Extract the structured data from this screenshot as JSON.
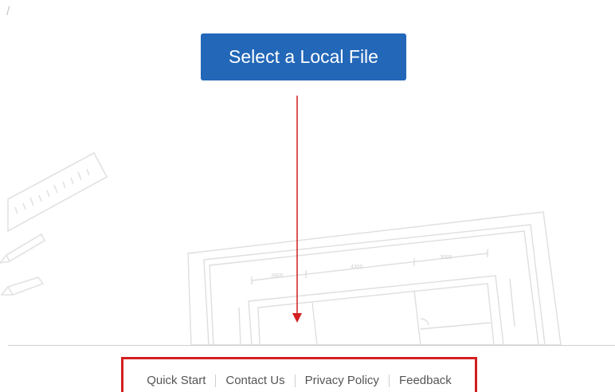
{
  "breadcrumb": {
    "separator": "/"
  },
  "main": {
    "select_button_label": "Select a Local File"
  },
  "footer": {
    "links": [
      "Quick Start",
      "Contact Us",
      "Privacy Policy",
      "Feedback"
    ]
  },
  "colors": {
    "button_bg": "#2267b8",
    "annotation_red": "#d21f1f",
    "footer_text": "#555555"
  },
  "icons": [
    "ruler-drawing",
    "pencil-drawing",
    "floor-plan-drawing",
    "down-arrow-annotation"
  ]
}
